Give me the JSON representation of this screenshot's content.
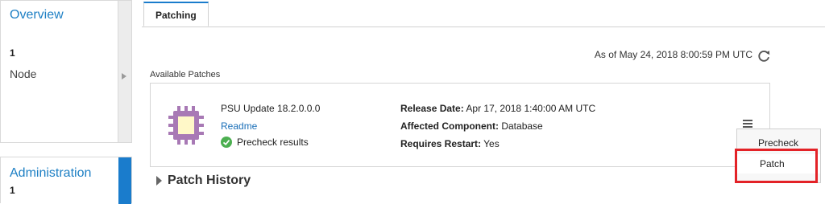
{
  "sidebar": {
    "overview": {
      "title": "Overview",
      "count": "1",
      "label": "Node"
    },
    "administration": {
      "title": "Administration",
      "count": "1"
    }
  },
  "tabs": [
    {
      "label": "Patching",
      "selected": true
    }
  ],
  "status": {
    "as_of": "As of May 24, 2018 8:00:59 PM UTC"
  },
  "available_patches": {
    "heading": "Available Patches",
    "patch": {
      "name": "PSU Update 18.2.0.0.0",
      "readme_link": "Readme",
      "precheck_results": "Precheck results",
      "details": [
        {
          "label": "Release Date:",
          "value": "Apr 17, 2018 1:40:00 AM UTC"
        },
        {
          "label": "Affected Component:",
          "value": "Database"
        },
        {
          "label": "Requires Restart:",
          "value": "Yes"
        }
      ]
    }
  },
  "patch_history": {
    "label": "Patch History"
  },
  "action_menu": {
    "items": [
      {
        "label": "Precheck"
      },
      {
        "label": "Patch"
      }
    ],
    "highlighted": "Patch"
  },
  "icons": {
    "refresh": "refresh-icon",
    "patch": "chip-icon",
    "precheck": "check-circle-icon",
    "actions": "hamburger-menu-icon",
    "history_toggle": "expand-arrow-icon"
  },
  "colors": {
    "accent": "#1a7ccc",
    "link": "#1a6fb8",
    "success": "#4caf50",
    "patch_icon": "#a879b5",
    "highlight": "#e32227"
  }
}
